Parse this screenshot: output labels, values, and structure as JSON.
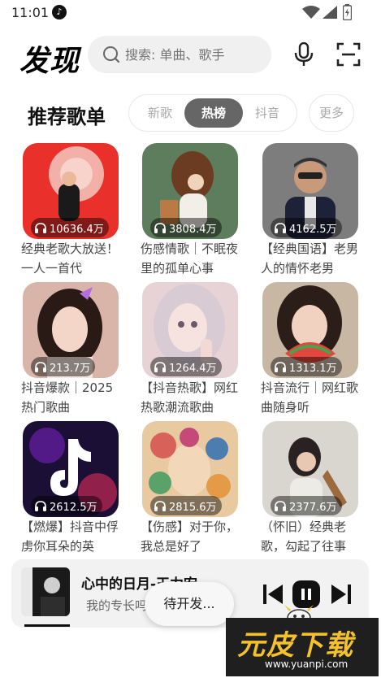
{
  "status_bar": {
    "time": "11:01",
    "app_icon": "tiktok-note-icon"
  },
  "header": {
    "brand": "发现",
    "search_placeholder": "搜索: 单曲、歌手"
  },
  "section": {
    "title": "推荐歌单",
    "tabs": [
      "新歌",
      "热榜",
      "抖音"
    ],
    "active_tab": "热榜",
    "more_label": "更多"
  },
  "playlists": [
    {
      "plays": "10636.4万",
      "title": "经典老歌大放送！一人一首代"
    },
    {
      "plays": "3808.4万",
      "title": "伤感情歌｜不眠夜里的孤单心事"
    },
    {
      "plays": "4162.5万",
      "title": "【经典国语】老男人的情怀老男"
    },
    {
      "plays": "213.7万",
      "title": "抖音爆款｜2025热门歌曲"
    },
    {
      "plays": "1264.4万",
      "title": "【抖音热歌】网红热歌潮流歌曲"
    },
    {
      "plays": "1313.1万",
      "title": "抖音流行｜网红歌曲随身听"
    },
    {
      "plays": "2612.5万",
      "title": "【燃爆】抖音中俘虏你耳朵的英"
    },
    {
      "plays": "2815.6万",
      "title": "【伤感】对于你，我总是好了"
    },
    {
      "plays": "2377.6万",
      "title": "（怀旧）经典老歌，勾起了往事"
    }
  ],
  "player": {
    "title": "心中的日月-王力宏",
    "subtitle": "我的专长吗",
    "progress": 0.13
  },
  "toast": "待开发...",
  "watermark": {
    "logo": "元皮下载",
    "url": "www.yuanpi.com"
  },
  "colors": {
    "active_tab_bg": "#666666",
    "watermark_yellow": "#f4c12b"
  }
}
